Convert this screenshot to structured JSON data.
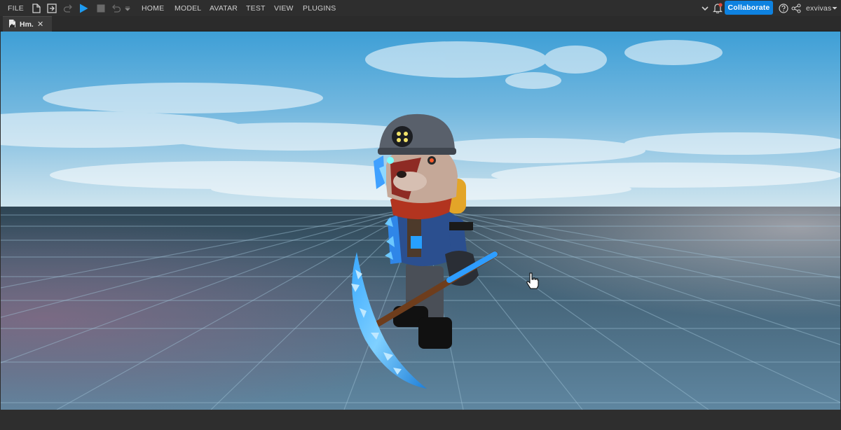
{
  "menubar": {
    "file_label": "FILE",
    "tabs": [
      {
        "label": "HOME"
      },
      {
        "label": "MODEL"
      },
      {
        "label": "AVATAR"
      },
      {
        "label": "TEST"
      },
      {
        "label": "VIEW"
      },
      {
        "label": "PLUGINS"
      }
    ],
    "collaborate_label": "Collaborate",
    "username": "exvivas"
  },
  "document_tabs": [
    {
      "label": "Hm.",
      "icon": "place-icon"
    }
  ],
  "colors": {
    "accent": "#0e82e0",
    "play": "#1e9bf0",
    "notification": "#e0483a",
    "chrome_bg": "#2e2e2e"
  },
  "icons": {
    "new": "new-file-icon",
    "open": "open-file-icon",
    "redo": "redo-icon",
    "play": "play-icon",
    "stop": "stop-icon",
    "undo": "undo-icon",
    "dropdown": "chevron-down-icon",
    "notification": "bell-icon",
    "help": "help-icon",
    "share": "share-icon",
    "cursor": "hand-cursor-icon"
  }
}
